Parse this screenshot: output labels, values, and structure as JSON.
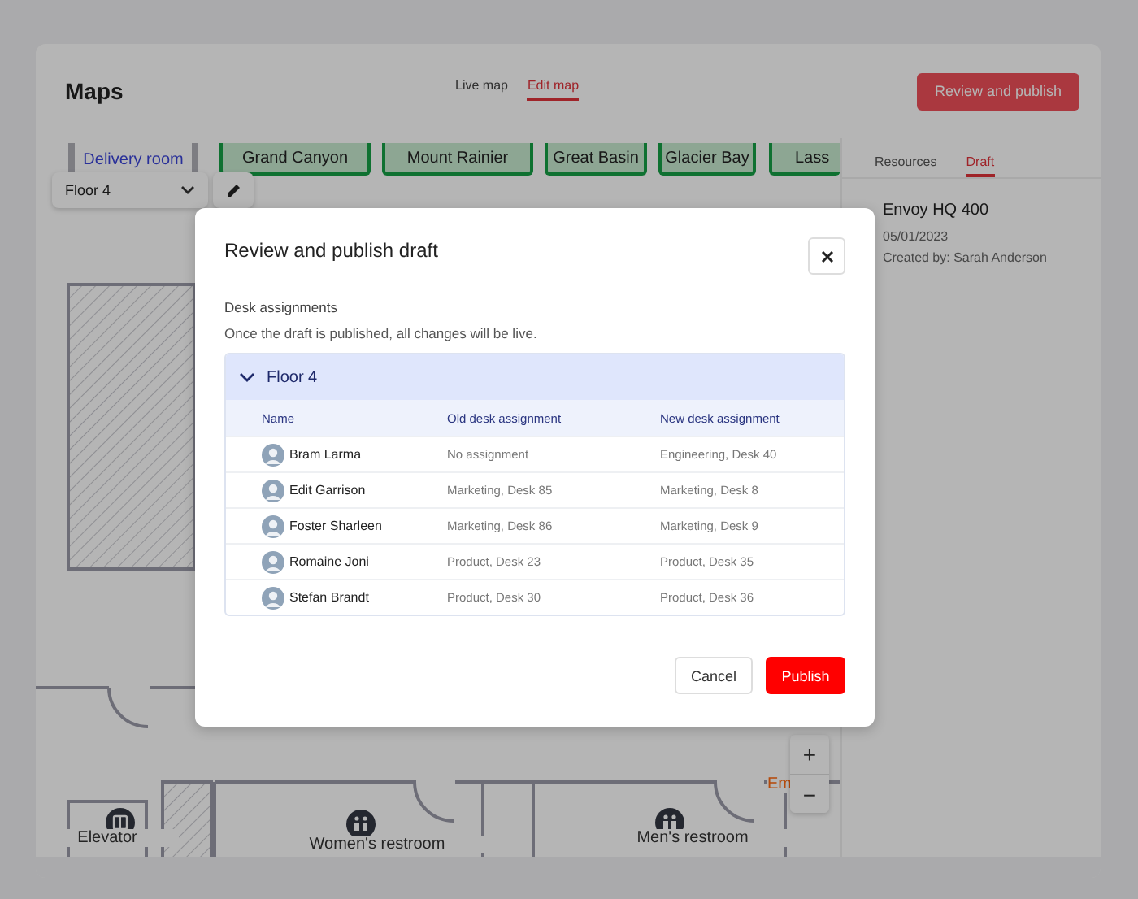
{
  "header": {
    "title": "Maps",
    "tabs": [
      {
        "label": "Live map",
        "selected": false
      },
      {
        "label": "Edit map",
        "selected": true
      }
    ],
    "primary_button": "Review and publish"
  },
  "map": {
    "floor_select": "Floor 4",
    "rooms": [
      {
        "name": "Delivery room",
        "kind": "room"
      },
      {
        "name": "Grand Canyon",
        "kind": "desk_area"
      },
      {
        "name": "Mount Rainier",
        "kind": "desk_area"
      },
      {
        "name": "Great Basin",
        "kind": "desk_area"
      },
      {
        "name": "Glacier Bay",
        "kind": "desk_area"
      },
      {
        "name": "Lass",
        "kind": "desk_area"
      }
    ],
    "amenities": [
      {
        "label": "Elevator",
        "kind": "elevator"
      },
      {
        "label": "Women's restroom",
        "kind": "restroom"
      },
      {
        "label": "Men's restroom",
        "kind": "restroom"
      }
    ],
    "partial_label": "Em",
    "zoom_controls": [
      "+",
      "−"
    ]
  },
  "side_panel": {
    "tabs": [
      {
        "label": "Resources",
        "selected": false
      },
      {
        "label": "Draft",
        "selected": true
      }
    ],
    "draft": {
      "title": "Envoy HQ 400",
      "date": "05/01/2023",
      "created_by": "Created by: Sarah Anderson"
    }
  },
  "modal": {
    "title": "Review and publish draft",
    "section_title": "Desk assignments",
    "note": "Once the draft is published, all changes will be live.",
    "group": {
      "label": "Floor 4",
      "expanded": true
    },
    "columns": [
      "Name",
      "Old desk assignment",
      "New desk assignment"
    ],
    "rows": [
      {
        "name": "Bram Larma",
        "old": "No assignment",
        "new": "Engineering, Desk 40"
      },
      {
        "name": "Edit Garrison",
        "old": "Marketing, Desk 85",
        "new": "Marketing, Desk 8"
      },
      {
        "name": "Foster Sharleen",
        "old": "Marketing, Desk 86",
        "new": "Marketing, Desk 9"
      },
      {
        "name": "Romaine Joni",
        "old": "Product, Desk 23",
        "new": "Product, Desk 35"
      },
      {
        "name": "Stefan Brandt",
        "old": "Product, Desk 30",
        "new": "Product, Desk 36"
      }
    ],
    "buttons": [
      {
        "label": "Cancel",
        "kind": "secondary"
      },
      {
        "label": "Publish",
        "kind": "primary"
      }
    ]
  }
}
